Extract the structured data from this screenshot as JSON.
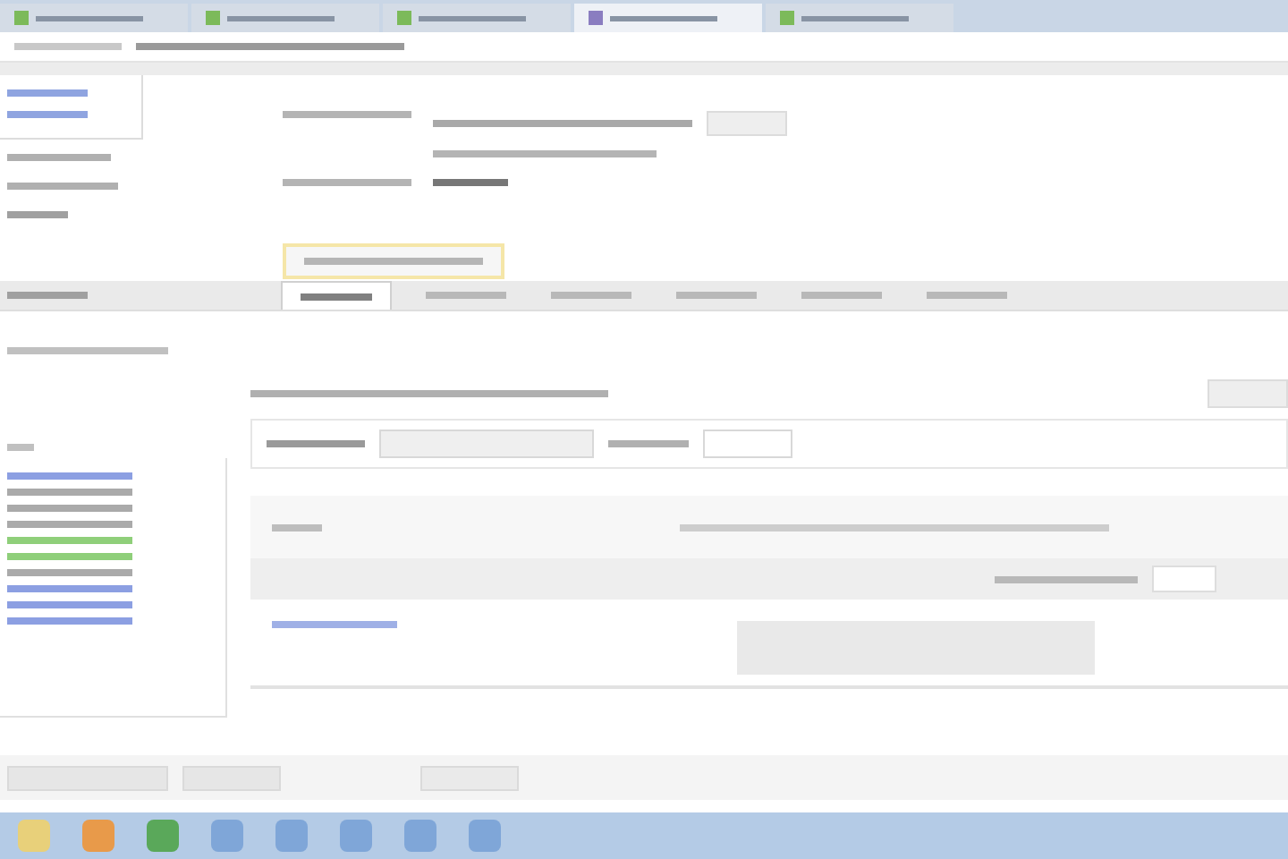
{
  "browser_tabs": [
    {
      "selected": false
    },
    {
      "selected": false
    },
    {
      "selected": false
    },
    {
      "selected": true
    },
    {
      "selected": false
    }
  ],
  "section_tabs": [
    {
      "selected": true
    },
    {
      "selected": false
    },
    {
      "selected": false
    },
    {
      "selected": false
    },
    {
      "selected": false
    },
    {
      "selected": false
    }
  ],
  "sidebar_items": [
    {
      "kind": "link"
    },
    {
      "kind": "text"
    },
    {
      "kind": "text"
    },
    {
      "kind": "text"
    },
    {
      "kind": "success"
    },
    {
      "kind": "success"
    },
    {
      "kind": "text"
    },
    {
      "kind": "link"
    },
    {
      "kind": "link"
    },
    {
      "kind": "link"
    }
  ],
  "taskbar": [
    {
      "kind": "folder"
    },
    {
      "kind": "player"
    },
    {
      "kind": "browser"
    },
    {
      "kind": "app"
    },
    {
      "kind": "app"
    },
    {
      "kind": "app"
    },
    {
      "kind": "app"
    },
    {
      "kind": "app"
    }
  ]
}
